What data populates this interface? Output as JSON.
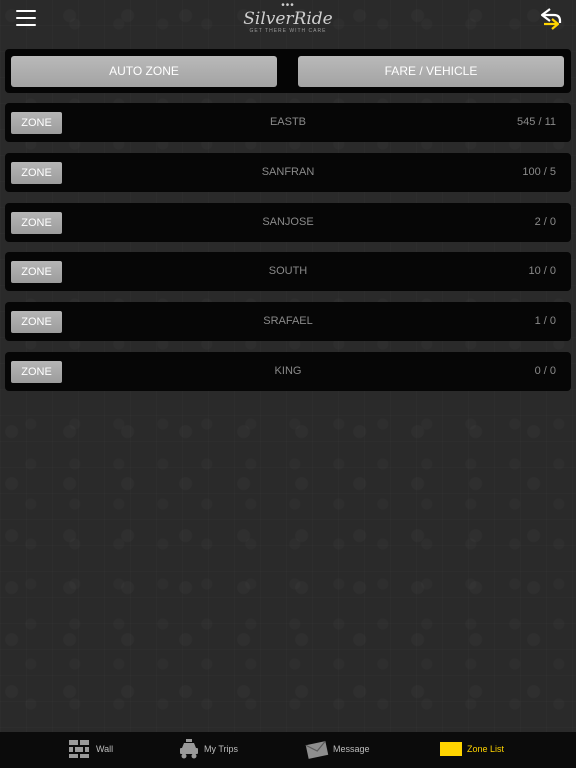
{
  "header": {
    "logo_text": "SilverRide",
    "logo_tagline": "GET THERE WITH CARE",
    "logo_dots": "•••"
  },
  "top_buttons": {
    "auto_zone": "AUTO ZONE",
    "fare_vehicle": "FARE / VEHICLE"
  },
  "zones": [
    {
      "button": "ZONE",
      "name": "EASTB",
      "count": "545 / 11"
    },
    {
      "button": "ZONE",
      "name": "SANFRAN",
      "count": "100 / 5"
    },
    {
      "button": "ZONE",
      "name": "SANJOSE",
      "count": "2 / 0"
    },
    {
      "button": "ZONE",
      "name": "SOUTH",
      "count": "10 / 0"
    },
    {
      "button": "ZONE",
      "name": "SRAFAEL",
      "count": "1 / 0"
    },
    {
      "button": "ZONE",
      "name": "KING",
      "count": "0 / 0"
    }
  ],
  "tabs": [
    {
      "label": "Wall",
      "icon": "wall-icon"
    },
    {
      "label": "My Trips",
      "icon": "taxi-icon"
    },
    {
      "label": "Message",
      "icon": "envelope-icon"
    },
    {
      "label": "Zone List",
      "icon": "zone-list-icon",
      "active": true
    }
  ],
  "colors": {
    "accent": "#ffd400",
    "background": "#2a2a2a",
    "row": "#060606",
    "button": "#aaaaaa"
  }
}
